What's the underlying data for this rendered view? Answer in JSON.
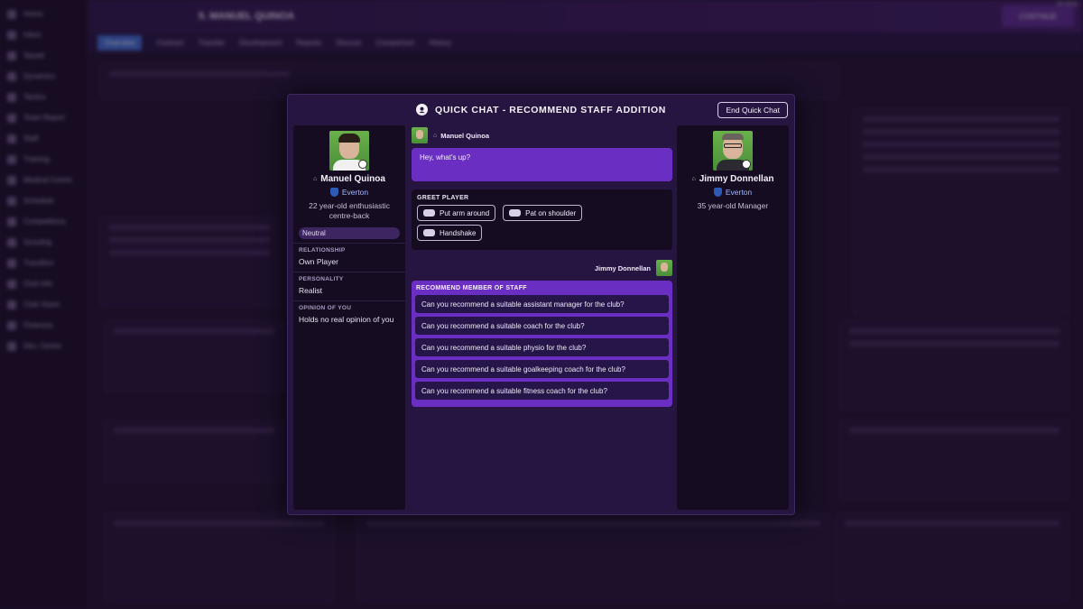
{
  "window": {
    "fps": "35 FPS",
    "player_header": "5. MANUEL QUINOA",
    "continue_label": "CONTINUE"
  },
  "background": {
    "sidebar_items": [
      "Home",
      "Inbox",
      "Squad",
      "Dynamics",
      "Tactics",
      "Team Report",
      "Staff",
      "Training",
      "Medical Centre",
      "Schedule",
      "Competitions",
      "Scouting",
      "Transfers",
      "Club Info",
      "Club Vision",
      "Finances",
      "Dev. Centre"
    ],
    "subnav_items": [
      "Overview",
      "Contract",
      "Transfer",
      "Development",
      "Reports",
      "Discuss",
      "Comparison",
      "History"
    ]
  },
  "modal": {
    "title": "QUICK CHAT - RECOMMEND STAFF ADDITION",
    "end_label": "End Quick Chat"
  },
  "player": {
    "name": "Manuel Quinoa",
    "club": "Everton",
    "description": "22 year-old enthusiastic centre-back",
    "mood": "Neutral",
    "relationship_label": "RELATIONSHIP",
    "relationship": "Own Player",
    "personality_label": "PERSONALITY",
    "personality": "Realist",
    "opinion_label": "OPINION OF YOU",
    "opinion": "Holds no real opinion of you"
  },
  "manager": {
    "name": "Jimmy Donnellan",
    "club": "Everton",
    "description": "35 year-old Manager"
  },
  "chat": {
    "player_author": "Manuel Quinoa",
    "player_message": "Hey, what's up?",
    "greet_label": "GREET PLAYER",
    "greet_options": [
      "Put arm around",
      "Pat on shoulder",
      "Handshake"
    ],
    "manager_author": "Jimmy Donnellan",
    "staff_label": "RECOMMEND MEMBER OF STAFF",
    "staff_options": [
      "Can you recommend a suitable assistant manager for the club?",
      "Can you recommend a suitable coach for the club?",
      "Can you recommend a suitable physio for the club?",
      "Can you recommend a suitable goalkeeping coach for the club?",
      "Can you recommend a suitable fitness coach for the club?"
    ]
  },
  "colors": {
    "accent_purple": "#6a2fc2",
    "modal_bg": "#251540",
    "panel_dark": "#150c22",
    "club_blue": "#9fb8ff"
  }
}
